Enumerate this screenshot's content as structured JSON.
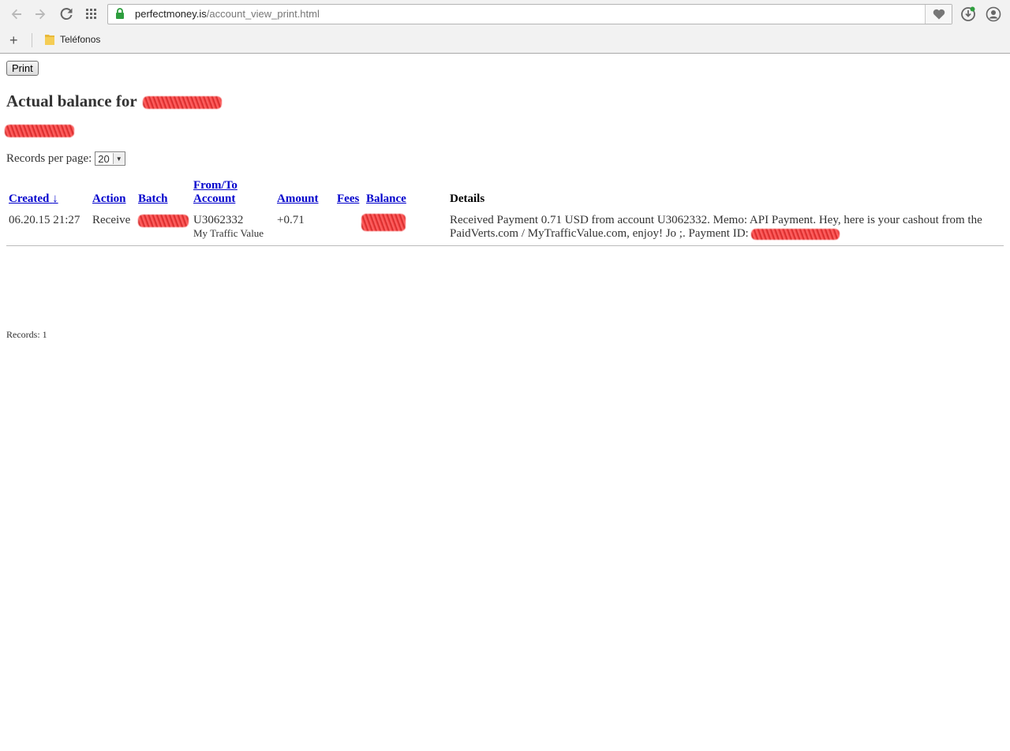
{
  "browser": {
    "url_domain": "perfectmoney.is",
    "url_path": "/account_view_print.html",
    "bookmark_folder": "Teléfonos"
  },
  "page": {
    "print_label": "Print",
    "title_prefix": "Actual balance for",
    "records_per_page_label": "Records per page:",
    "records_per_page_value": "20",
    "records_footer": "Records: 1"
  },
  "table": {
    "headers": {
      "created": "Created",
      "sort_arrow": "↓",
      "action": "Action",
      "batch": "Batch",
      "from_to": "From/To Account",
      "amount": "Amount",
      "fees": "Fees",
      "balance": "Balance",
      "details": "Details"
    },
    "rows": [
      {
        "created": "06.20.15 21:27",
        "action": "Receive",
        "account": "U3062332",
        "account_name": "My Traffic Value",
        "amount": "+0.71",
        "fees": "",
        "details": "Received Payment 0.71 USD from account U3062332. Memo: API Payment. Hey, here is your cashout from the PaidVerts.com / MyTrafficValue.com, enjoy! Jo ;. Payment ID:"
      }
    ]
  },
  "colors": {
    "link": "#0000cc",
    "positive_amount": "#007d00",
    "redaction": "#e02020",
    "lock": "#2e9e3e"
  },
  "icons": [
    "back-icon",
    "forward-icon",
    "reload-icon",
    "apps-icon",
    "lock-icon",
    "heart-icon",
    "download-icon",
    "profile-icon",
    "add-icon",
    "folder-icon"
  ]
}
